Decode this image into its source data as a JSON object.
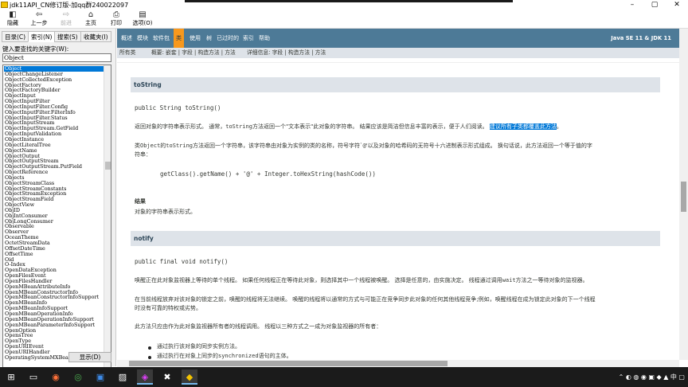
{
  "window": {
    "title": "jdk11API_CN修订版-加qq群240022097",
    "minimize": "–",
    "maximize": "▢",
    "close": "✕"
  },
  "toolbar": [
    {
      "label": "隐藏",
      "glyph": "◧",
      "disabled": false
    },
    {
      "label": "上一步",
      "glyph": "⇦",
      "disabled": false
    },
    {
      "label": "前进",
      "glyph": "⇨",
      "disabled": true
    },
    {
      "label": "主页",
      "glyph": "⌂",
      "disabled": false
    },
    {
      "label": "打印",
      "glyph": "⎙",
      "disabled": false
    },
    {
      "label": "选项(O)",
      "glyph": "▤",
      "disabled": false
    }
  ],
  "left": {
    "tabs": [
      "目录(C)",
      "索引(N)",
      "搜索(S)",
      "收藏夹(I)"
    ],
    "active_tab": 1,
    "keyword_label": "键入要查找的关键字(W):",
    "keyword_value": "Object",
    "selected_index": 0,
    "items": [
      "Object",
      "ObjectChangeListener",
      "ObjectCollectedException",
      "ObjectFactory",
      "ObjectFactoryBuilder",
      "ObjectInput",
      "ObjectInputFilter",
      "ObjectInputFilter.Config",
      "ObjectInputFilter.FilterInfo",
      "ObjectInputFilter.Status",
      "ObjectInputStream",
      "ObjectInputStream.GetField",
      "ObjectInputValidation",
      "ObjectInstance",
      "ObjectLiteralTree",
      "ObjectName",
      "ObjectOutput",
      "ObjectOutputStream",
      "ObjectOutputStream.PutField",
      "ObjectReference",
      "Objects",
      "ObjectStreamClass",
      "ObjectStreamConstants",
      "ObjectStreamException",
      "ObjectStreamField",
      "ObjectView",
      "ObjID",
      "ObjIntConsumer",
      "ObjLongConsumer",
      "Observable",
      "Observer",
      "OceanTheme",
      "OctetStreamData",
      "OffsetDateTime",
      "OffsetTime",
      "Oid",
      "O-Index",
      "OpenDataException",
      "OpenFilesEvent",
      "OpenFilesHandler",
      "OpenMBeanAttributeInfo",
      "OpenMBeanConstructorInfo",
      "OpenMBeanConstructorInfoSupport",
      "OpenMBeanInfo",
      "OpenMBeanInfoSupport",
      "OpenMBeanOperationInfo",
      "OpenMBeanOperationInfoSupport",
      "OpenMBeanParameterInfoSupport",
      "OpenOption",
      "OpensTree",
      "OpenType",
      "OpenURIEvent",
      "OpenURIHandler",
      "OperatingSystemMXBean"
    ],
    "show_button": "显示(D)"
  },
  "navbar": {
    "items": [
      "概述",
      "模块",
      "软件包",
      "类",
      "使用",
      "树",
      "已过时的",
      "索引",
      "帮助"
    ],
    "active_index": 3,
    "right": "Java SE 11 & JDK 11"
  },
  "subnav": {
    "all_classes": "所有类",
    "summary": "概要: 嵌套 | 字段 | 构造方法 | 方法",
    "detail": "详细信息: 字段 | 构造方法 | 方法"
  },
  "doc": {
    "s1_title": "toString",
    "s1_sig": "public String toString()",
    "s1_p1a": "返回对象的字符串表示形式。 通常，",
    "s1_p1code": "toString",
    "s1_p1b": "方法返回一个\"文本表示\"此对象的字符串。 结果应该是简洁但信息丰富的表示，便于人们阅读。",
    "s1_p1hl": "建议所有子类都覆盖此方法",
    "s1_p1end": "。",
    "s1_p2a": "类",
    "s1_p2code1": "Object",
    "s1_p2b": "的",
    "s1_p2code2": "toString",
    "s1_p2c": "方法返回一个字符串，该字符串由对象为实例的类的名称，符号字符`",
    "s1_p2code3": "@",
    "s1_p2d": "'以及对象的哈希码的无符号十六进制表示形式组成。 换句话说，此方法返回一个等于值的字",
    "s1_p2e": "符串：",
    "s1_code": "getClass().getName() + '@' + Integer.toHexString(hashCode())",
    "s1_result_label": "结果",
    "s1_result_text": "对象的字符串表示形式。",
    "s2_title": "notify",
    "s2_sig": "public final void notify()",
    "s2_p1a": "唤醒正在此对象监视器上等待的单个线程。 如果任何线程正在等待此对象，则选择其中一个线程被唤醒。 选择是任意的，由实施决定。 线程通过调用",
    "s2_p1code": "wait",
    "s2_p1b": "方法之一等待对象的监视器。",
    "s2_p2a": "在当前线程放弃对该对象的锁定之前，唤醒的线程将无法继续。 唤醒的线程将以通常的方式与可能正在竞争同步此对象的任何其他线程竞争;例如，唤醒线程在成为锁定此对象的下一个线程",
    "s2_p2b": "时没有可靠的特权或劣势。",
    "s2_p3": "此方法只应由作为此对象监视器所有者的线程调用。 线程以三种方式之一成为对象监视器的所有者：",
    "s2_b1": "通过执行该对象的同步实例方法。",
    "s2_b2a": "通过执行在对象上同步的",
    "s2_b2code": "synchronized",
    "s2_b2b": "语句的主体。"
  },
  "taskbar": {
    "icons": [
      "⊞",
      "▭",
      "◉",
      "◎",
      "▣",
      "▨",
      "◈",
      "✖",
      "◆"
    ],
    "tray": "⌃ ◐ ◍ ◉ ▣ ◆ ▲ 中 ▢"
  },
  "colors": {
    "nav_bg": "#4d7a97",
    "nav_active": "#f8981d",
    "subnav_bg": "#dee3e9",
    "selection": "#0078d7"
  }
}
